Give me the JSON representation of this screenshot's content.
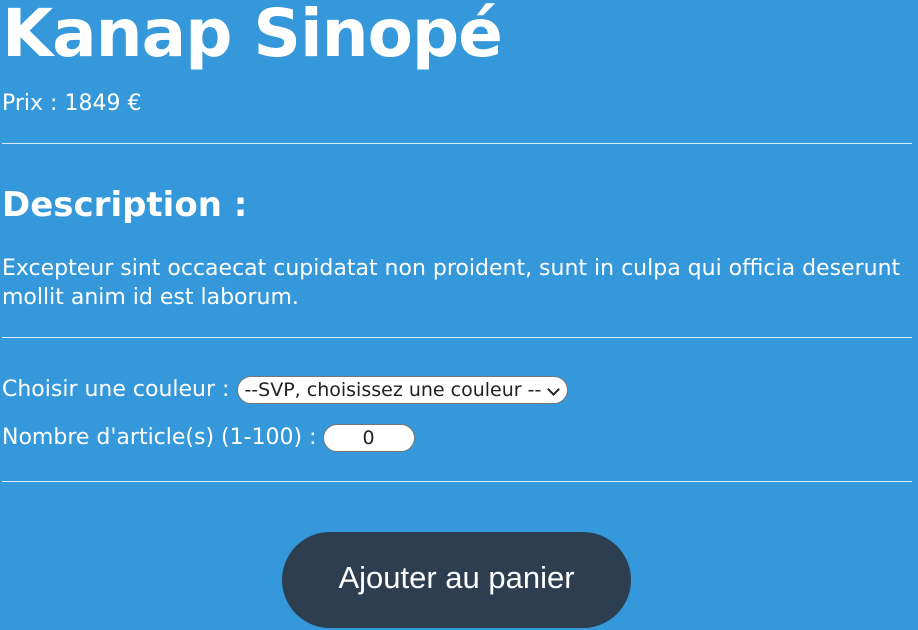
{
  "product": {
    "title": "Kanap Sinopé",
    "price_label": "Prix :",
    "price_value": "1849",
    "currency": "€"
  },
  "description": {
    "heading": "Description :",
    "text": "Excepteur sint occaecat cupidatat non proident, sunt in culpa qui officia deserunt mollit anim id est laborum."
  },
  "options": {
    "color_label": "Choisir une couleur :",
    "color_selected": "--SVP, choisissez une couleur --",
    "quantity_label": "Nombre d'article(s) (1-100) :",
    "quantity_value": "0"
  },
  "actions": {
    "add_to_cart_label": "Ajouter au panier"
  },
  "colors": {
    "background": "#3498db",
    "button": "#2c3e50",
    "text": "#ffffff"
  }
}
